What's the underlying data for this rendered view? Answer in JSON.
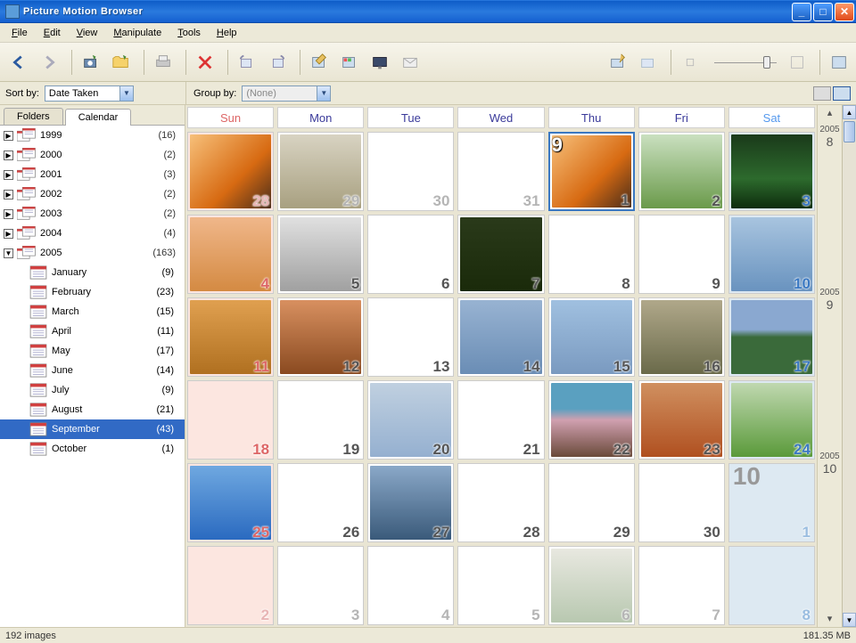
{
  "title": "Picture Motion Browser",
  "menu": [
    "File",
    "Edit",
    "View",
    "Manipulate",
    "Tools",
    "Help"
  ],
  "sort_label": "Sort by:",
  "sort_value": "Date Taken",
  "group_label": "Group by:",
  "group_value": "(None)",
  "tabs": {
    "folders": "Folders",
    "calendar": "Calendar"
  },
  "years": [
    {
      "y": "1999",
      "c": "(16)"
    },
    {
      "y": "2000",
      "c": "(2)"
    },
    {
      "y": "2001",
      "c": "(3)"
    },
    {
      "y": "2002",
      "c": "(2)"
    },
    {
      "y": "2003",
      "c": "(2)"
    },
    {
      "y": "2004",
      "c": "(4)"
    },
    {
      "y": "2005",
      "c": "(163)",
      "expanded": true
    }
  ],
  "months": [
    {
      "m": "January",
      "c": "(9)"
    },
    {
      "m": "February",
      "c": "(23)"
    },
    {
      "m": "March",
      "c": "(15)"
    },
    {
      "m": "April",
      "c": "(11)"
    },
    {
      "m": "May",
      "c": "(17)"
    },
    {
      "m": "June",
      "c": "(14)"
    },
    {
      "m": "July",
      "c": "(9)"
    },
    {
      "m": "August",
      "c": "(21)"
    },
    {
      "m": "September",
      "c": "(43)",
      "selected": true
    },
    {
      "m": "October",
      "c": "(1)"
    }
  ],
  "day_headers": [
    "Sun",
    "Mon",
    "Tue",
    "Wed",
    "Thu",
    "Fri",
    "Sat"
  ],
  "cells": [
    {
      "n": "28",
      "cls": "sun other",
      "th": "th-sunset"
    },
    {
      "n": "29",
      "cls": "other",
      "th": "th-haze"
    },
    {
      "n": "30",
      "cls": "other"
    },
    {
      "n": "31",
      "cls": "other"
    },
    {
      "n": "1",
      "cls": "today",
      "th": "th-sunset",
      "badge": "9"
    },
    {
      "n": "2",
      "th": "th-bird"
    },
    {
      "n": "3",
      "cls": "sat",
      "th": "th-forest"
    },
    {
      "n": "4",
      "cls": "sun",
      "th": "th-dog1"
    },
    {
      "n": "5",
      "th": "th-dog2"
    },
    {
      "n": "6"
    },
    {
      "n": "7",
      "th": "th-cat"
    },
    {
      "n": "8"
    },
    {
      "n": "9"
    },
    {
      "n": "10",
      "cls": "sat",
      "th": "th-flock"
    },
    {
      "n": "11",
      "cls": "sun",
      "th": "th-gold"
    },
    {
      "n": "12",
      "th": "th-dach"
    },
    {
      "n": "13"
    },
    {
      "n": "14",
      "th": "th-swan"
    },
    {
      "n": "15",
      "th": "th-cloud"
    },
    {
      "n": "16",
      "th": "th-arch"
    },
    {
      "n": "17",
      "cls": "sat",
      "th": "th-mount"
    },
    {
      "n": "18",
      "cls": "sun"
    },
    {
      "n": "19"
    },
    {
      "n": "20",
      "th": "th-gull"
    },
    {
      "n": "21"
    },
    {
      "n": "22",
      "th": "th-blossom"
    },
    {
      "n": "23",
      "th": "th-autumn"
    },
    {
      "n": "24",
      "cls": "sat",
      "th": "th-grass"
    },
    {
      "n": "25",
      "cls": "sun",
      "th": "th-blue"
    },
    {
      "n": "26"
    },
    {
      "n": "27",
      "th": "th-lake"
    },
    {
      "n": "28"
    },
    {
      "n": "29"
    },
    {
      "n": "30"
    },
    {
      "n": "1",
      "cls": "sat other",
      "next": "10"
    },
    {
      "n": "2",
      "cls": "sun other"
    },
    {
      "n": "3",
      "cls": "other"
    },
    {
      "n": "4",
      "cls": "other"
    },
    {
      "n": "5",
      "cls": "other"
    },
    {
      "n": "6",
      "cls": "other",
      "th": "th-desk"
    },
    {
      "n": "7",
      "cls": "other"
    },
    {
      "n": "8",
      "cls": "sat other"
    }
  ],
  "vstrip": [
    {
      "yr": "2005",
      "mo": "8"
    },
    {
      "yr": "2005",
      "mo": "9"
    },
    {
      "yr": "2005",
      "mo": "10"
    }
  ],
  "status_left": "192 images",
  "status_right": "181.35 MB"
}
